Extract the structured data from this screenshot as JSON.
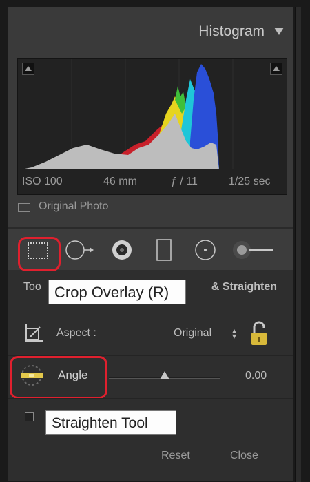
{
  "histogram": {
    "title": "Histogram",
    "collapse_icon": "triangle-down-icon",
    "info": {
      "iso": "ISO 100",
      "focal_length": "46 mm",
      "aperture": "ƒ / 11",
      "shutter": "1/25 sec"
    },
    "original_photo_label": "Original Photo"
  },
  "toolstrip": {
    "tools": [
      "crop-overlay-icon",
      "spot-removal-icon",
      "red-eye-icon",
      "graduated-filter-icon",
      "radial-filter-icon",
      "adjustment-brush-icon"
    ],
    "highlight_color": "#e0202e"
  },
  "crop_panel": {
    "title_left": "Too",
    "title_right": "& Straighten",
    "tooltip": "Crop Overlay (R)",
    "aspect": {
      "label": "Aspect :",
      "value": "Original"
    },
    "angle": {
      "label": "Angle",
      "value": "0.00",
      "slider_fraction": 0.5
    },
    "straighten_tooltip": "Straighten Tool",
    "reset_label": "Reset",
    "close_label": "Close"
  }
}
